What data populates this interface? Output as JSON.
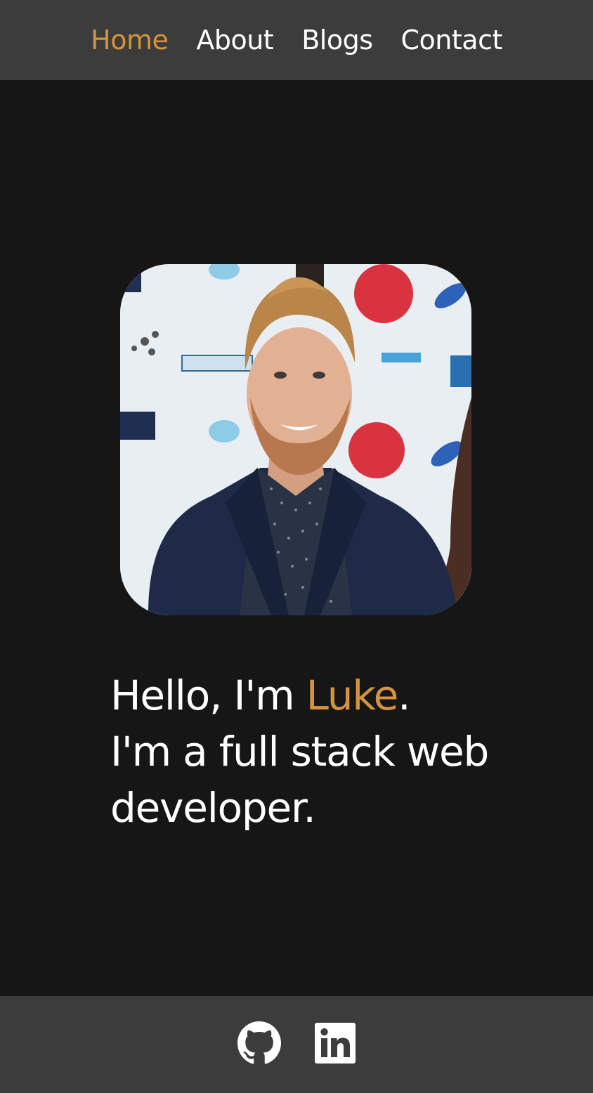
{
  "nav": {
    "items": [
      {
        "label": "Home",
        "active": true
      },
      {
        "label": "About",
        "active": false
      },
      {
        "label": "Blogs",
        "active": false
      },
      {
        "label": "Contact",
        "active": false
      }
    ]
  },
  "hero": {
    "greeting": "Hello, I'm ",
    "name": "Luke",
    "period": ".",
    "tagline": "I'm a full stack web developer."
  },
  "footer": {
    "icons": [
      "github-icon",
      "linkedin-icon"
    ]
  },
  "colors": {
    "accent": "#d4943b",
    "background": "#161616",
    "bar": "#3d3c3d",
    "text": "#ffffff"
  }
}
